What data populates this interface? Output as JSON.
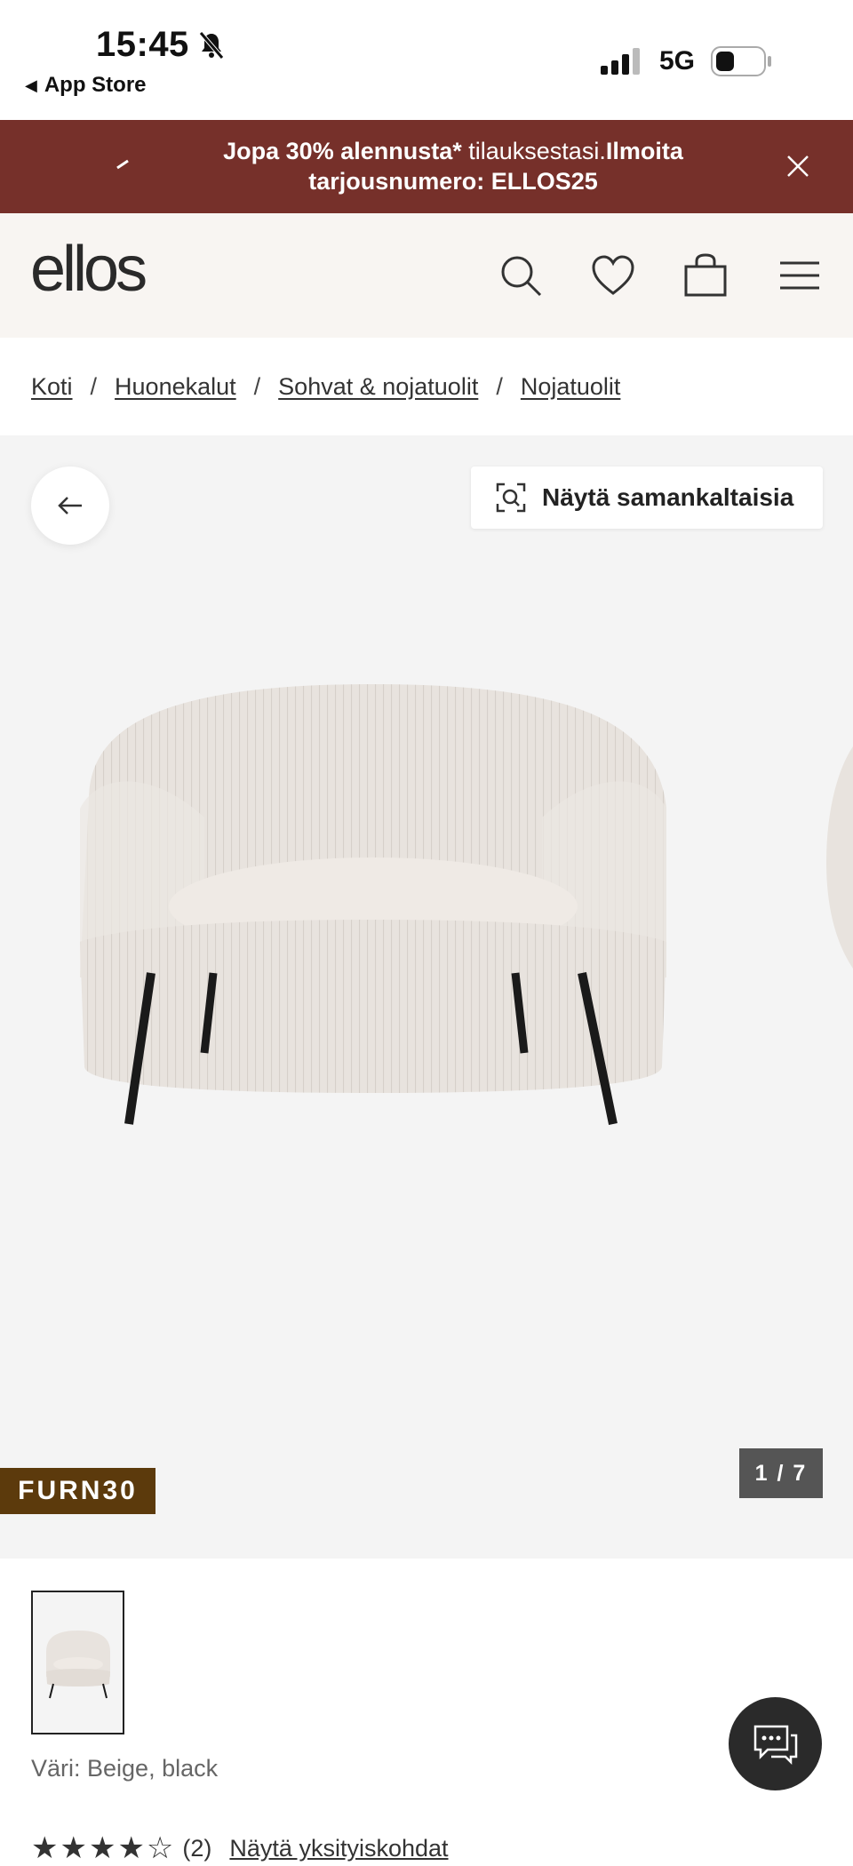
{
  "status_bar": {
    "time": "15:45",
    "back_label": "App Store",
    "network": "5G"
  },
  "promo_bar": {
    "bold_1": "Jopa 30% alennusta*",
    "regular": " tilauksestasi.",
    "bold_2": "Ilmoita tarjousnumero: ELLOS25"
  },
  "header": {
    "logo": "ellos"
  },
  "breadcrumb": [
    {
      "label": "Koti"
    },
    {
      "label": "Huonekalut"
    },
    {
      "label": "Sohvat & nojatuolit"
    },
    {
      "label": "Nojatuolit"
    }
  ],
  "breadcrumb_separator": "/",
  "gallery": {
    "similar_button": "Näytä samankaltaisia",
    "promo_tag": "FURN30",
    "counter": "1 / 7"
  },
  "product": {
    "color_label": "Väri: Beige, black",
    "rating_count": "(2)",
    "rating_link": "Näytä yksityiskohdat",
    "stars": "★★★★☆"
  },
  "colors": {
    "promo_bg": "#76302a",
    "header_bg": "#f8f5f2",
    "tag_bg": "#5c3a0c",
    "gallery_bg": "#f4f4f4"
  }
}
